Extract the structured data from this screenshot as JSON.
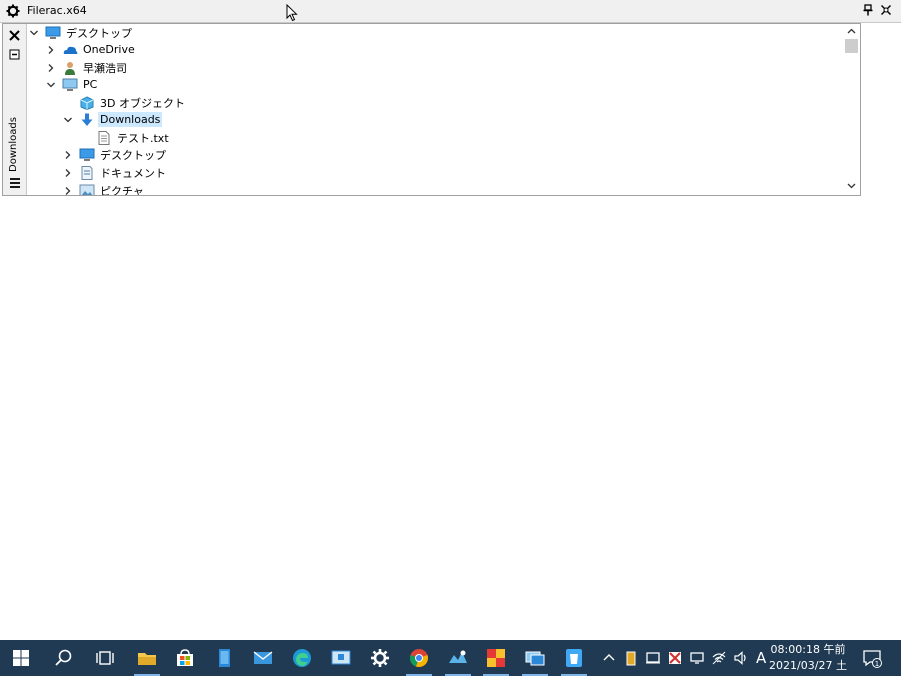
{
  "window": {
    "title": "Filerac.x64",
    "gear_icon": "gear-icon",
    "pin_icon": "pin-icon",
    "close_icon": "close-icon"
  },
  "side_panel": {
    "close_icon": "close-icon",
    "collapse_icon": "collapse-icon",
    "vertical_label": "Downloads",
    "menu_icon": "hamburger-icon"
  },
  "tree": {
    "items": [
      {
        "label": "デスクトップ",
        "icon": "desktop-icon",
        "expanded": true,
        "selected": false
      },
      {
        "label": "OneDrive",
        "icon": "onedrive-icon",
        "expanded": false,
        "selected": false
      },
      {
        "label": "早瀬浩司",
        "icon": "user-icon",
        "expanded": false,
        "selected": false
      },
      {
        "label": "PC",
        "icon": "pc-icon",
        "expanded": true,
        "selected": false
      },
      {
        "label": "3D オブジェクト",
        "icon": "3d-objects-icon",
        "expanded": null,
        "selected": false
      },
      {
        "label": "Downloads",
        "icon": "downloads-icon",
        "expanded": true,
        "selected": true
      },
      {
        "label": "テスト.txt",
        "icon": "text-file-icon",
        "expanded": null,
        "selected": false
      },
      {
        "label": "デスクトップ",
        "icon": "desktop-icon",
        "expanded": false,
        "selected": false
      },
      {
        "label": "ドキュメント",
        "icon": "documents-icon",
        "expanded": false,
        "selected": false
      },
      {
        "label": "ピクチャ",
        "icon": "pictures-icon",
        "expanded": false,
        "selected": false
      }
    ]
  },
  "taskbar": {
    "apps": [
      "windows-start-icon",
      "search-icon",
      "task-view-icon",
      "file-explorer-icon",
      "store-icon",
      "notepad-icon",
      "mail-icon",
      "edge-icon",
      "remote-icon",
      "settings-icon",
      "chrome-icon",
      "app-icon",
      "puzzle-app-icon",
      "network-app-icon",
      "recycle-app-icon"
    ],
    "ime_label": "A",
    "clock_time": "08:00:18 午前",
    "clock_date": "2021/03/27 土",
    "notification_count": "1"
  },
  "colors": {
    "taskbar_bg": "#1f3a52",
    "selection_bg": "#cce8ff",
    "titlebar_bg": "#f0f0f0"
  }
}
